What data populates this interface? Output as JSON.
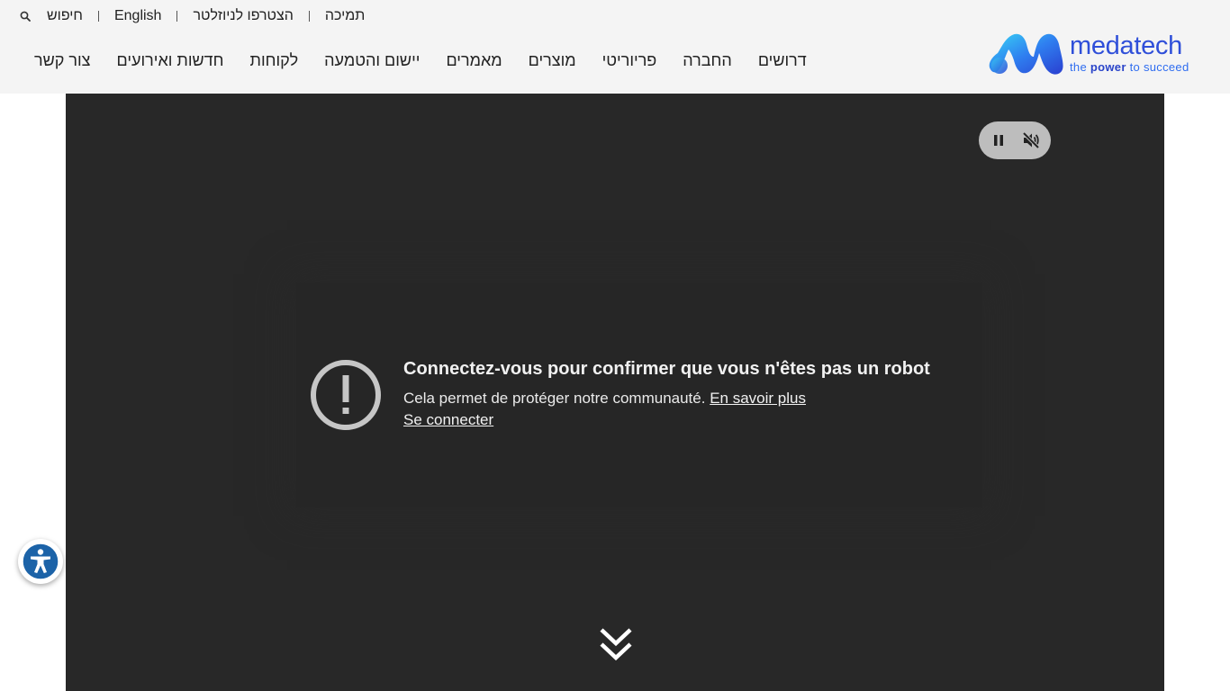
{
  "header": {
    "topbar": {
      "search_label": "חיפוש",
      "english_label": "English",
      "newsletter_label": "הצטרפו לניוזלטר",
      "support_label": "תמיכה"
    },
    "nav": {
      "items": [
        {
          "label": "צור קשר"
        },
        {
          "label": "חדשות ואירועים"
        },
        {
          "label": "לקוחות"
        },
        {
          "label": "יישום והטמעה"
        },
        {
          "label": "מאמרים"
        },
        {
          "label": "מוצרים"
        },
        {
          "label": "פריוריטי"
        },
        {
          "label": "החברה"
        },
        {
          "label": "דרושים"
        }
      ]
    },
    "logo": {
      "brand": "medatech",
      "tagline_pre": "the ",
      "tagline_bold": "power",
      "tagline_post": " to succeed"
    }
  },
  "video": {
    "title": "Connectez-vous pour confirmer que vous n'êtes pas un robot",
    "description": "Cela permet de protéger notre communauté.",
    "learn_more_label": "En savoir plus",
    "signin_label": "Se connecter",
    "controls": {
      "pause_icon": "pause-icon",
      "mute_icon": "volume-muted-icon"
    }
  },
  "accessibility": {
    "icon": "accessibility-icon"
  },
  "colors": {
    "header_bg": "#f4f4f4",
    "video_bg": "#282828",
    "brand_blue": "#2f4fd9",
    "accessibility_blue": "#1c63a8"
  }
}
